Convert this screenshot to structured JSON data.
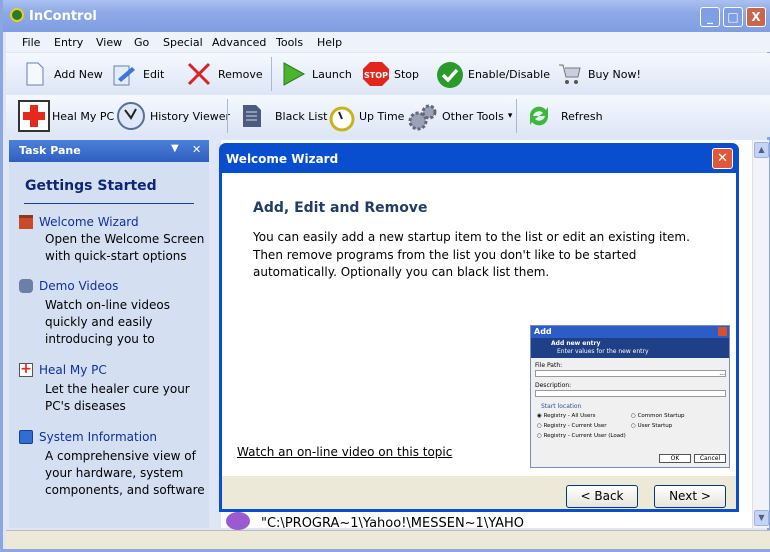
{
  "window": {
    "title": "InControl",
    "minimize": "_",
    "maximize": "□",
    "close": "X"
  },
  "menu": [
    "File",
    "Entry",
    "View",
    "Go",
    "Special",
    "Advanced",
    "Tools",
    "Help"
  ],
  "toolbar1": [
    {
      "label": "Add New",
      "icon": "new-document-icon"
    },
    {
      "label": "Edit",
      "icon": "edit-pencil-icon"
    },
    {
      "label": "Remove",
      "icon": "red-x-icon"
    },
    {
      "label": "Launch",
      "icon": "play-icon"
    },
    {
      "label": "Stop",
      "icon": "stop-sign-icon",
      "icon_text": "STOP"
    },
    {
      "label": "Enable/Disable",
      "icon": "green-check-icon"
    },
    {
      "label": "Buy Now!",
      "icon": "shopping-cart-icon"
    }
  ],
  "toolbar2": [
    {
      "label": "Heal My PC",
      "icon": "red-cross-icon"
    },
    {
      "label": "History Viewer",
      "icon": "clock-icon"
    },
    {
      "label": "Black List",
      "icon": "list-document-icon"
    },
    {
      "label": "Up Time",
      "icon": "stopwatch-icon"
    },
    {
      "label": "Other Tools",
      "icon": "gears-icon",
      "dropdown": "▾"
    },
    {
      "label": "Refresh",
      "icon": "refresh-icon"
    }
  ],
  "task_pane": {
    "title": "Task Pane",
    "heading": "Gettings Started",
    "items": [
      {
        "title": "Welcome Wizard",
        "desc": "Open the Welcome Screen with quick-start options",
        "icon": "wizard-icon"
      },
      {
        "title": "Demo Videos",
        "desc": "Watch on-line videos quickly and easily introducing you to",
        "icon": "camera-icon"
      },
      {
        "title": "Heal My PC",
        "desc": "Let the healer cure your PC's diseases",
        "icon": "red-cross-icon"
      },
      {
        "title": "System Information",
        "desc": "A comprehensive view of your hardware, system components, and software",
        "icon": "info-icon"
      }
    ]
  },
  "list": {
    "visible_row": "\"C:\\PROGRA~1\\Yahoo!\\MESSEN~1\\YAHO"
  },
  "wizard": {
    "title": "Welcome Wizard",
    "heading": "Add, Edit and Remove",
    "body": "You can easily add a new startup item to the list or edit an existing item. Then remove programs from the list you don't like to be started automatically. Optionally you can black list them.",
    "video_link": "Watch an on-line video on this topic",
    "back": "< Back",
    "next": "Next >",
    "preview": {
      "title": "Add",
      "header": "Add new entry",
      "subheader": "Enter values for the new entry",
      "file_path": "File Path:",
      "description": "Description:",
      "group": "Start location",
      "options": [
        "Registry - All Users",
        "Registry - Current User",
        "Registry - Current User (Load)",
        "Common Startup",
        "User Startup"
      ],
      "selected": "Registry - All Users",
      "ok": "OK",
      "cancel": "Cancel",
      "browse": "..."
    }
  },
  "colors": {
    "title_bar": "#8ea9e6",
    "wizard_title": "#0a4ed0",
    "task_pane_bg": "#d4e0f2",
    "link": "#0e2f9c"
  }
}
